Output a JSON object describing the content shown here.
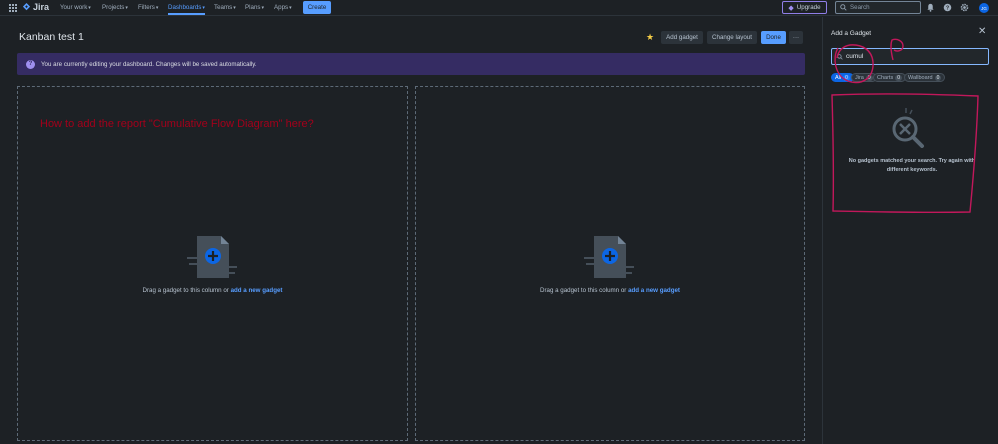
{
  "nav": {
    "logo": "Jira",
    "items": [
      {
        "label": "Your work",
        "active": false
      },
      {
        "label": "Projects",
        "active": false
      },
      {
        "label": "Filters",
        "active": false
      },
      {
        "label": "Dashboards",
        "active": true
      },
      {
        "label": "Teams",
        "active": false
      },
      {
        "label": "Plans",
        "active": false
      },
      {
        "label": "Apps",
        "active": false
      }
    ],
    "create_label": "Create",
    "upgrade_label": "Upgrade",
    "search_placeholder": "Search",
    "avatar_initials": "JG"
  },
  "dashboard": {
    "title": "Kanban test 1",
    "buttons": {
      "add_gadget": "Add gadget",
      "change_layout": "Change layout",
      "done": "Done",
      "more": "···"
    },
    "info_message": "You are currently editing your dashboard. Changes will be saved automatically.",
    "annotation": "How to add the report \"Cumulative Flow Diagram\" here?",
    "columns": [
      {
        "drop_text": "Drag a gadget to this column or",
        "link_text": "add a new gadget"
      },
      {
        "drop_text": "Drag a gadget to this column or",
        "link_text": "add a new gadget"
      }
    ]
  },
  "panel": {
    "title": "Add a Gadget",
    "search_value": "cumul",
    "filters": [
      {
        "label": "All",
        "count": "0",
        "active": true
      },
      {
        "label": "Jira",
        "count": "0",
        "active": false
      },
      {
        "label": "Charts",
        "count": "0",
        "active": false
      },
      {
        "label": "Wallboard",
        "count": "0",
        "active": false
      }
    ],
    "empty_message": "No gadgets matched your search. Try again with different keywords."
  },
  "colors": {
    "background": "#1d2125",
    "accent": "#579dff",
    "info_bar": "#352c63",
    "annotation": "#a3001b",
    "markup_pen": "#c2185b"
  }
}
